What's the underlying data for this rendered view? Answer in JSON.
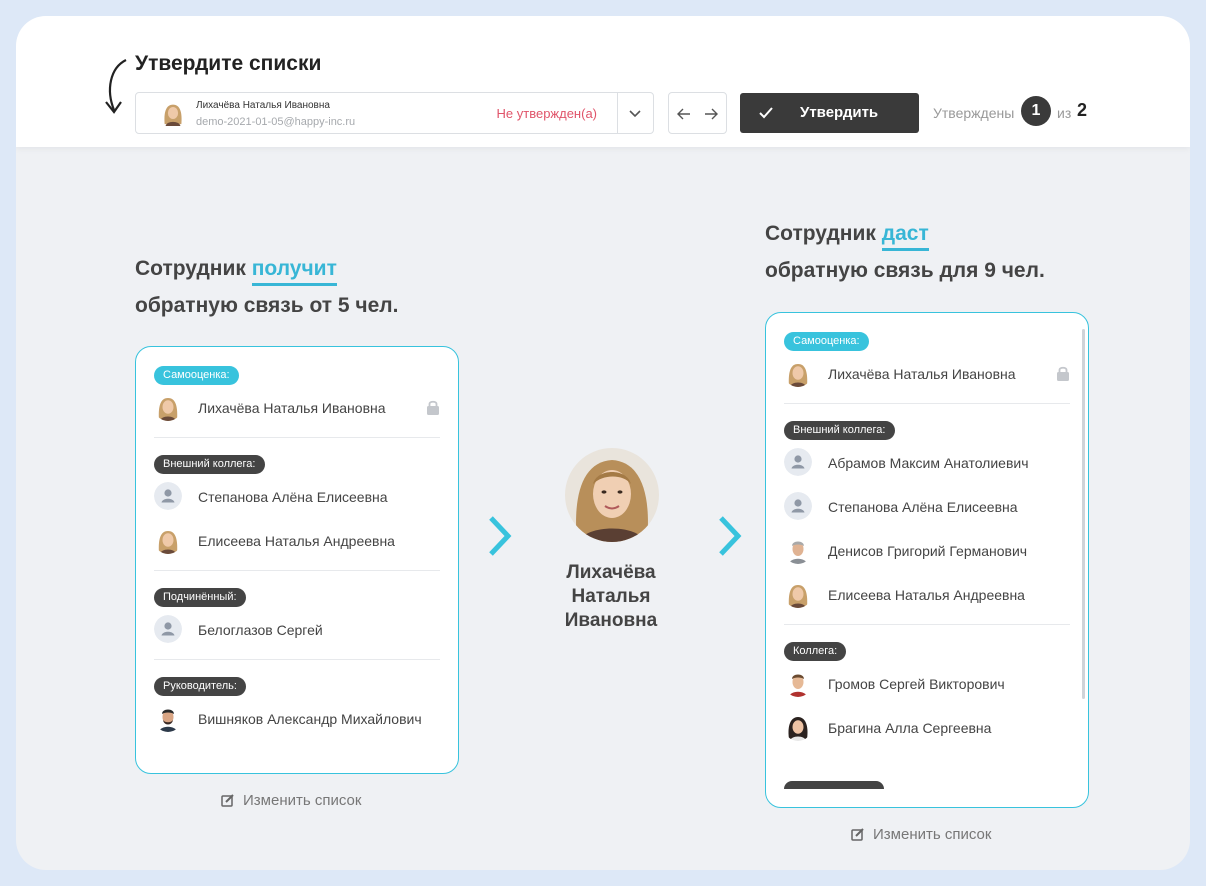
{
  "header": {
    "title": "Утвердите списки",
    "selected_employee": {
      "name": "Лихачёва Наталья Ивановна",
      "email": "demo-2021-01-05@happy-inc.ru",
      "status": "Не утвержден(а)"
    },
    "approve_label": "Утвердить",
    "approved_label": "Утверждены",
    "approved_count": "1",
    "of_label": "из",
    "total_count": "2"
  },
  "receives": {
    "prefix": "Сотрудник",
    "highlight": "получит",
    "suffix": "обратную связь от 5 чел.",
    "groups": [
      {
        "label": "Самооценка:",
        "type": "self",
        "people": [
          {
            "name": "Лихачёва Наталья Ивановна",
            "avatar": "woman-blonde",
            "locked": true
          }
        ]
      },
      {
        "label": "Внешний коллега:",
        "type": "other",
        "people": [
          {
            "name": "Степанова Алёна Елисеевна",
            "avatar": "placeholder"
          },
          {
            "name": "Елисеева Наталья Андреевна",
            "avatar": "woman-blonde"
          }
        ]
      },
      {
        "label": "Подчинённый:",
        "type": "other",
        "people": [
          {
            "name": "Белоглазов Сергей",
            "avatar": "placeholder"
          }
        ]
      },
      {
        "label": "Руководитель:",
        "type": "other",
        "people": [
          {
            "name": "Вишняков Александр Михайлович",
            "avatar": "man-dark"
          }
        ]
      }
    ],
    "edit_label": "Изменить список"
  },
  "center": {
    "name_line1": "Лихачёва",
    "name_line2": "Наталья",
    "name_line3": "Ивановна"
  },
  "gives": {
    "prefix": "Сотрудник",
    "highlight": "даст",
    "suffix": "обратную связь для 9 чел.",
    "groups": [
      {
        "label": "Самооценка:",
        "type": "self",
        "people": [
          {
            "name": "Лихачёва Наталья Ивановна",
            "avatar": "woman-blonde",
            "locked": true
          }
        ]
      },
      {
        "label": "Внешний коллега:",
        "type": "other",
        "people": [
          {
            "name": "Абрамов Максим Анатолиевич",
            "avatar": "placeholder"
          },
          {
            "name": "Степанова Алёна Елисеевна",
            "avatar": "placeholder"
          },
          {
            "name": "Денисов Григорий Германович",
            "avatar": "man-grey"
          },
          {
            "name": "Елисеева Наталья Андреевна",
            "avatar": "woman-blonde"
          }
        ]
      },
      {
        "label": "Коллега:",
        "type": "other",
        "people": [
          {
            "name": "Громов Сергей Викторович",
            "avatar": "man-brown"
          },
          {
            "name": "Брагина Алла Сергеевна",
            "avatar": "woman-dark"
          }
        ]
      }
    ],
    "edit_label": "Изменить список"
  },
  "colors": {
    "accent": "#38c3dd",
    "dark": "#3a3a3a",
    "status_red": "#e0546a"
  }
}
